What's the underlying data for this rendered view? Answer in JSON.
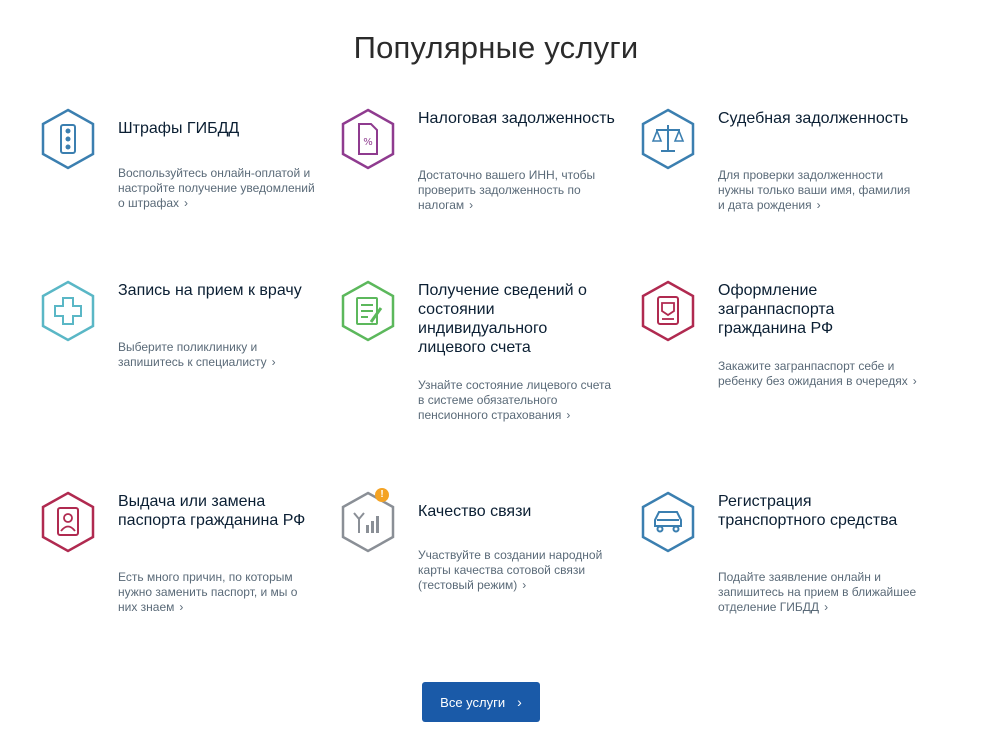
{
  "page": {
    "title": "Популярные услуги"
  },
  "services": [
    {
      "name": "Штрафы ГИБДД",
      "desc": "Воспользуйтесь онлайн-оплатой и настройте получение уведомлений о штрафах",
      "icon": "traffic-light-icon",
      "color": "#3b7fb0"
    },
    {
      "name": "Налоговая задолженность",
      "desc": "Достаточно вашего ИНН, чтобы проверить задолженность по налогам",
      "icon": "tax-document-icon",
      "color": "#8f3b8f"
    },
    {
      "name": "Судебная задолженность",
      "desc": "Для проверки задолженности нужны только ваши имя, фамилия и дата рождения",
      "icon": "scales-icon",
      "color": "#3b7fb0"
    },
    {
      "name": "Запись на прием к врачу",
      "desc": "Выберите поликлинику и запишитесь к специалисту",
      "icon": "medical-cross-icon",
      "color": "#5ab7c6"
    },
    {
      "name": "Получение сведений о состоянии индивидуального лицевого счета",
      "desc": "Узнайте состояние лицевого счета в системе обязательного пенсионного страхования",
      "icon": "document-edit-icon",
      "color": "#5cb85c"
    },
    {
      "name": "Оформление загранпаспорта гражданина РФ",
      "desc": "Закажите загранпаспорт себе и ребенку без ожидания в очередях",
      "icon": "passport-icon",
      "color": "#b02a50"
    },
    {
      "name": "Выдача или замена паспорта гражданина РФ",
      "desc": "Есть много причин, по которым нужно заменить паспорт, и мы о них знаем",
      "icon": "id-card-icon",
      "color": "#b02a50"
    },
    {
      "name": "Качество связи",
      "desc": "Участвуйте в создании народной карты качества сотовой связи (тестовый режим)",
      "icon": "signal-icon",
      "color": "#8a8f96",
      "badge": "!"
    },
    {
      "name": "Регистрация транспортного средства",
      "desc": "Подайте заявление онлайн и запишитесь на прием в ближайшее отделение ГИБДД",
      "icon": "car-icon",
      "color": "#3b7fb0"
    }
  ],
  "all_services_button": {
    "label": "Все услуги"
  }
}
